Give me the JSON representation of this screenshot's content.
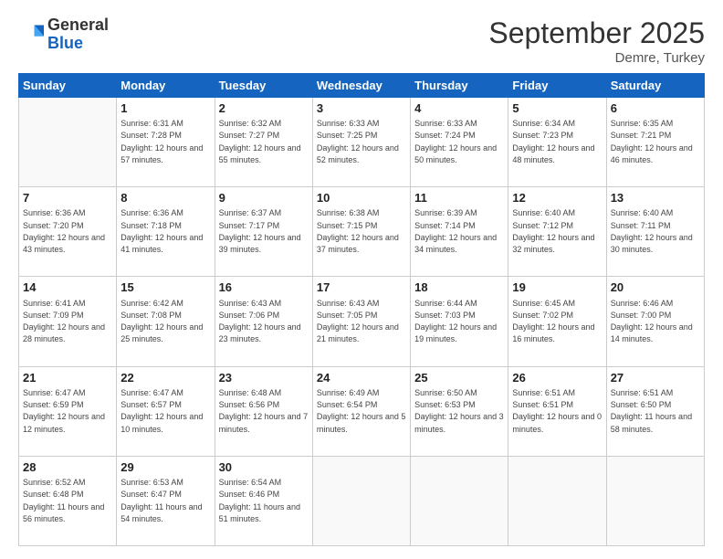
{
  "logo": {
    "general": "General",
    "blue": "Blue"
  },
  "header": {
    "month": "September 2025",
    "location": "Demre, Turkey"
  },
  "weekdays": [
    "Sunday",
    "Monday",
    "Tuesday",
    "Wednesday",
    "Thursday",
    "Friday",
    "Saturday"
  ],
  "weeks": [
    [
      {
        "day": "",
        "sunrise": "",
        "sunset": "",
        "daylight": "",
        "empty": true
      },
      {
        "day": "1",
        "sunrise": "6:31 AM",
        "sunset": "7:28 PM",
        "daylight": "12 hours and 57 minutes."
      },
      {
        "day": "2",
        "sunrise": "6:32 AM",
        "sunset": "7:27 PM",
        "daylight": "12 hours and 55 minutes."
      },
      {
        "day": "3",
        "sunrise": "6:33 AM",
        "sunset": "7:25 PM",
        "daylight": "12 hours and 52 minutes."
      },
      {
        "day": "4",
        "sunrise": "6:33 AM",
        "sunset": "7:24 PM",
        "daylight": "12 hours and 50 minutes."
      },
      {
        "day": "5",
        "sunrise": "6:34 AM",
        "sunset": "7:23 PM",
        "daylight": "12 hours and 48 minutes."
      },
      {
        "day": "6",
        "sunrise": "6:35 AM",
        "sunset": "7:21 PM",
        "daylight": "12 hours and 46 minutes."
      }
    ],
    [
      {
        "day": "7",
        "sunrise": "6:36 AM",
        "sunset": "7:20 PM",
        "daylight": "12 hours and 43 minutes."
      },
      {
        "day": "8",
        "sunrise": "6:36 AM",
        "sunset": "7:18 PM",
        "daylight": "12 hours and 41 minutes."
      },
      {
        "day": "9",
        "sunrise": "6:37 AM",
        "sunset": "7:17 PM",
        "daylight": "12 hours and 39 minutes."
      },
      {
        "day": "10",
        "sunrise": "6:38 AM",
        "sunset": "7:15 PM",
        "daylight": "12 hours and 37 minutes."
      },
      {
        "day": "11",
        "sunrise": "6:39 AM",
        "sunset": "7:14 PM",
        "daylight": "12 hours and 34 minutes."
      },
      {
        "day": "12",
        "sunrise": "6:40 AM",
        "sunset": "7:12 PM",
        "daylight": "12 hours and 32 minutes."
      },
      {
        "day": "13",
        "sunrise": "6:40 AM",
        "sunset": "7:11 PM",
        "daylight": "12 hours and 30 minutes."
      }
    ],
    [
      {
        "day": "14",
        "sunrise": "6:41 AM",
        "sunset": "7:09 PM",
        "daylight": "12 hours and 28 minutes."
      },
      {
        "day": "15",
        "sunrise": "6:42 AM",
        "sunset": "7:08 PM",
        "daylight": "12 hours and 25 minutes."
      },
      {
        "day": "16",
        "sunrise": "6:43 AM",
        "sunset": "7:06 PM",
        "daylight": "12 hours and 23 minutes."
      },
      {
        "day": "17",
        "sunrise": "6:43 AM",
        "sunset": "7:05 PM",
        "daylight": "12 hours and 21 minutes."
      },
      {
        "day": "18",
        "sunrise": "6:44 AM",
        "sunset": "7:03 PM",
        "daylight": "12 hours and 19 minutes."
      },
      {
        "day": "19",
        "sunrise": "6:45 AM",
        "sunset": "7:02 PM",
        "daylight": "12 hours and 16 minutes."
      },
      {
        "day": "20",
        "sunrise": "6:46 AM",
        "sunset": "7:00 PM",
        "daylight": "12 hours and 14 minutes."
      }
    ],
    [
      {
        "day": "21",
        "sunrise": "6:47 AM",
        "sunset": "6:59 PM",
        "daylight": "12 hours and 12 minutes."
      },
      {
        "day": "22",
        "sunrise": "6:47 AM",
        "sunset": "6:57 PM",
        "daylight": "12 hours and 10 minutes."
      },
      {
        "day": "23",
        "sunrise": "6:48 AM",
        "sunset": "6:56 PM",
        "daylight": "12 hours and 7 minutes."
      },
      {
        "day": "24",
        "sunrise": "6:49 AM",
        "sunset": "6:54 PM",
        "daylight": "12 hours and 5 minutes."
      },
      {
        "day": "25",
        "sunrise": "6:50 AM",
        "sunset": "6:53 PM",
        "daylight": "12 hours and 3 minutes."
      },
      {
        "day": "26",
        "sunrise": "6:51 AM",
        "sunset": "6:51 PM",
        "daylight": "12 hours and 0 minutes."
      },
      {
        "day": "27",
        "sunrise": "6:51 AM",
        "sunset": "6:50 PM",
        "daylight": "11 hours and 58 minutes."
      }
    ],
    [
      {
        "day": "28",
        "sunrise": "6:52 AM",
        "sunset": "6:48 PM",
        "daylight": "11 hours and 56 minutes."
      },
      {
        "day": "29",
        "sunrise": "6:53 AM",
        "sunset": "6:47 PM",
        "daylight": "11 hours and 54 minutes."
      },
      {
        "day": "30",
        "sunrise": "6:54 AM",
        "sunset": "6:46 PM",
        "daylight": "11 hours and 51 minutes."
      },
      {
        "day": "",
        "sunrise": "",
        "sunset": "",
        "daylight": "",
        "empty": true
      },
      {
        "day": "",
        "sunrise": "",
        "sunset": "",
        "daylight": "",
        "empty": true
      },
      {
        "day": "",
        "sunrise": "",
        "sunset": "",
        "daylight": "",
        "empty": true
      },
      {
        "day": "",
        "sunrise": "",
        "sunset": "",
        "daylight": "",
        "empty": true
      }
    ]
  ],
  "labels": {
    "sunrise": "Sunrise:",
    "sunset": "Sunset:",
    "daylight": "Daylight:"
  }
}
